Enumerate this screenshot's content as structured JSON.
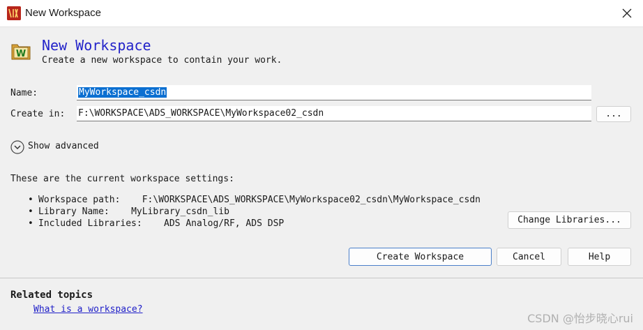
{
  "window": {
    "title": "New Workspace"
  },
  "header": {
    "title": "New Workspace",
    "subtitle": "Create a new workspace to contain your work."
  },
  "form": {
    "name_label": "Name:",
    "name_value": "MyWorkspace_csdn",
    "create_in_label": "Create in:",
    "create_in_value": "F:\\WORKSPACE\\ADS_WORKSPACE\\MyWorkspace02_csdn",
    "browse_label": "..."
  },
  "advanced": {
    "label": "Show advanced"
  },
  "settings": {
    "intro": "These are the current workspace settings:",
    "items": [
      {
        "key": "Workspace path:",
        "value": "F:\\WORKSPACE\\ADS_WORKSPACE\\MyWorkspace02_csdn\\MyWorkspace_csdn"
      },
      {
        "key": "Library Name:",
        "value": "MyLibrary_csdn_lib"
      },
      {
        "key": "Included Libraries:",
        "value": "ADS Analog/RF, ADS DSP"
      }
    ],
    "change_libraries_label": "Change Libraries..."
  },
  "buttons": {
    "create": "Create Workspace",
    "cancel": "Cancel",
    "help": "Help"
  },
  "related": {
    "title": "Related topics",
    "link": "What is a workspace?"
  },
  "watermark": "CSDN @怡步晓心rui",
  "colors": {
    "title_blue": "#2323c9",
    "link_blue": "#2020c8",
    "selection": "#0b6fd1"
  }
}
